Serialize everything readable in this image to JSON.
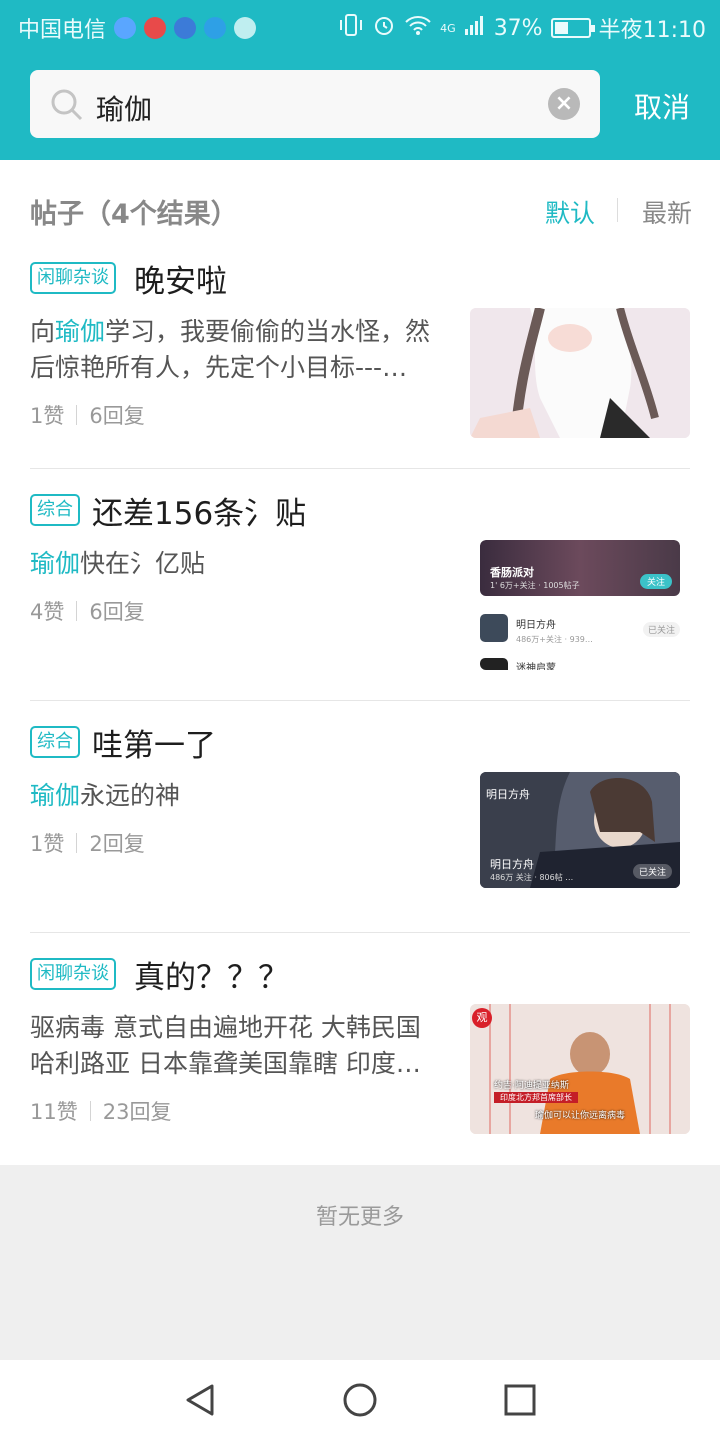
{
  "status_bar": {
    "carrier": "中国电信",
    "network": "4G",
    "battery": "37%",
    "time": "半夜11:10",
    "icons": [
      "music-app-icon",
      "netease-app-icon",
      "pen-app-icon",
      "browser-app-icon",
      "wechat-icon",
      "vibrate-icon",
      "alarm-icon",
      "wifi-icon",
      "signal-icon",
      "battery-icon"
    ]
  },
  "search": {
    "query": "瑜伽",
    "cancel_label": "取消"
  },
  "results": {
    "title": "帖子（4个结果）",
    "sort_default": "默认",
    "sort_newest": "最新"
  },
  "posts": [
    {
      "tag": "闲聊杂谈",
      "title": "晚安啦",
      "body_pre": "向",
      "body_hl": "瑜伽",
      "body_post": "学习，我要偷偷的当水怪，然后惊艳所有人，先定个小目标---…",
      "likes": "1赞",
      "replies": "6回复"
    },
    {
      "tag": "综合",
      "title": "还差156条氵贴",
      "body_pre": "",
      "body_hl": "瑜伽",
      "body_post": "快在氵亿贴",
      "likes": "4赞",
      "replies": "6回复",
      "thumb": {
        "banner_title": "香肠派对",
        "banner_sub": "1' 6万+关注 · 1005帖子",
        "banner_follow": "关注",
        "row1_name": "明日方舟",
        "row1_sub": "486万+关注 · 939…",
        "row1_status": "已关注",
        "row2_name": "迷神启蒙"
      }
    },
    {
      "tag": "综合",
      "title": "哇第一了",
      "body_pre": "",
      "body_hl": "瑜伽",
      "body_post": "永远的神",
      "likes": "1赞",
      "replies": "2回复",
      "thumb": {
        "logo_text": "明日方舟",
        "name": "明日方舟",
        "sub": "486万 关注 · 806帖 …",
        "status": "已关注"
      }
    },
    {
      "tag": "闲聊杂谈",
      "title": "真的？？？",
      "body_pre": "",
      "body_hl": "",
      "body_post": "驱病毒 意式自由遍地开花 大韩民国哈利路亚 日本靠聋美国靠瞎 印度…",
      "likes": "11赞",
      "replies": "23回复",
      "thumb": {
        "badge": "观",
        "caption_name": "约吉·阿迪提亚纳斯",
        "caption_role": "印度北方邦首席部长",
        "subtitle": "瑜伽可以让你远离病毒"
      }
    }
  ],
  "footer": {
    "no_more": "暂无更多"
  },
  "nav": {
    "back": "back-icon",
    "home": "home-icon",
    "recents": "recents-icon"
  }
}
